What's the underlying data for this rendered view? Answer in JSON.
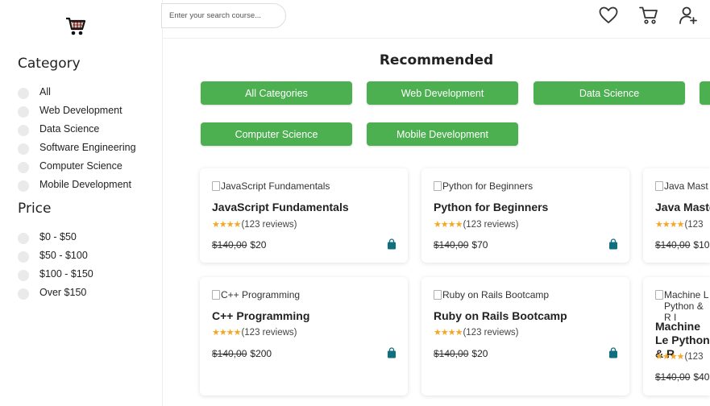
{
  "header": {
    "search_placeholder": "Enter your search course...",
    "icons": [
      "heart-icon",
      "cart-icon",
      "add-user-icon"
    ]
  },
  "sidebar": {
    "logo": "cart-logo-icon",
    "category_heading": "Category",
    "categories": [
      "All",
      "Web Development",
      "Data Science",
      "Software Engineering",
      "Computer Science",
      "Mobile Development"
    ],
    "price_heading": "Price",
    "prices": [
      "$0 - $50",
      "$50 - $100",
      "$100 - $150",
      "Over $150"
    ]
  },
  "main": {
    "title": "Recommended",
    "category_buttons": [
      "All Categories",
      "Web Development",
      "Data Science",
      "Computer Science",
      "Mobile Development"
    ],
    "courses": [
      {
        "image_alt": "JavaScript Fundamentals",
        "title": "JavaScript Fundamentals",
        "reviews": "(123 reviews)",
        "old_price": "$140,00",
        "price": "$20"
      },
      {
        "image_alt": "Python for Beginners",
        "title": "Python for Beginners",
        "reviews": "(123 reviews)",
        "old_price": "$140,00",
        "price": "$70"
      },
      {
        "image_alt": "Java Mast",
        "title": "Java Maste",
        "reviews": "(123",
        "old_price": "$140,00",
        "price": "$10"
      },
      {
        "image_alt": "C++ Programming",
        "title": "C++ Programming",
        "reviews": "(123 reviews)",
        "old_price": "$140,00",
        "price": "$200"
      },
      {
        "image_alt": "Ruby on Rails Bootcamp",
        "title": "Ruby on Rails Bootcamp",
        "reviews": "(123 reviews)",
        "old_price": "$140,00",
        "price": "$20"
      },
      {
        "image_alt": "Machine L Python & R I",
        "title": "Machine Le Python & R",
        "reviews": "(123",
        "old_price": "$140,00",
        "price": "$40"
      }
    ],
    "stars": "★★★★"
  },
  "colors": {
    "accent": "#4caf50",
    "star": "#f5a623",
    "bag": "#0f6f7f"
  }
}
